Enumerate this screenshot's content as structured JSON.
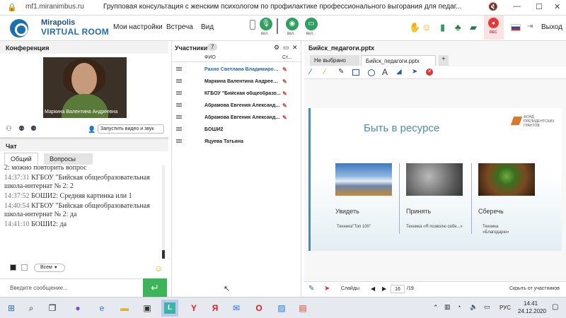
{
  "browser": {
    "url": "mf1.miranimbus.ru",
    "title": "Групповая консультация с женским психологом по профилактике профессионального выгорания для педаг..."
  },
  "app": {
    "brand_top": "Mirapolis",
    "brand_bottom": "VIRTUAL ROOM",
    "menu": [
      "Мои настройки",
      "Встреча",
      "Вид"
    ],
    "mic_label": "вкл.",
    "cam_label": "вкл.",
    "screen_label": "вкл.",
    "rec_label": "REC",
    "exit_label": "Выход",
    "accent": "#2e9f5e"
  },
  "conference": {
    "title": "Конференция",
    "video_name": "Маркина Валентина Андреевна",
    "start_video_select": "Запустить видео и звук"
  },
  "chat": {
    "title": "Чат",
    "tabs": [
      "Общий",
      "Вопросы"
    ],
    "messages": [
      {
        "time": "",
        "text": "2: можно повторить вопрос"
      },
      {
        "time": "14:37:31",
        "text": "КГБОУ \"Бийская общеобразовательная школа-интернат № 2: 2"
      },
      {
        "time": "14:37:52",
        "text": "БОШИ2: Средняя картинка или 1"
      },
      {
        "time": "14:40:54",
        "text": "КГБОУ \"Бийская общеобразовательная школа-интернат № 2: да"
      },
      {
        "time": "14:41:10",
        "text": "БОШИ2: да"
      }
    ],
    "recipient_select": "Всем",
    "input_placeholder": "Введите сообщение..."
  },
  "participants": {
    "title": "Участники",
    "count": "7",
    "col_name": "ФИО",
    "col_status": "Ст...",
    "rows": [
      {
        "name": "Рахно Светлана Владимировна",
        "highlight": true
      },
      {
        "name": "Маркина Валентина Андреевна",
        "highlight": false
      },
      {
        "name": "КГБОУ \"Бийская общеобразо...",
        "highlight": false
      },
      {
        "name": "Абрамова Евгения Александ...",
        "highlight": false
      },
      {
        "name": "Абрамова Евгения Александ...",
        "highlight": false
      },
      {
        "name": "БОШИ2",
        "highlight": false
      },
      {
        "name": "Яцуева Татьяна",
        "highlight": false
      }
    ]
  },
  "presentation": {
    "file_title": "Бийск_педагоги.pptx",
    "tabs": [
      "Не выбрано",
      "Бийск_педагоги.pptx",
      "+"
    ],
    "slide_title": "Быть в ресурсе",
    "fund_text": "ФОНД ПРЕЗИДЕНТСКИХ ГРАНТОВ",
    "columns": [
      {
        "caption": "Увидеть",
        "sub": "Техника\"Топ 100\""
      },
      {
        "caption": "Принять",
        "sub": "Техника «Я позволю себе...»"
      },
      {
        "caption": "Сберечь",
        "sub": "Техника «Благодарю»"
      }
    ],
    "slides_label": "Слайды",
    "current_slide": "16",
    "total_slides": "/19",
    "hide_from_participants": "Скрыть от участников"
  },
  "taskbar": {
    "lang": "РУС",
    "time": "14:41",
    "date": "24.12.2020"
  }
}
